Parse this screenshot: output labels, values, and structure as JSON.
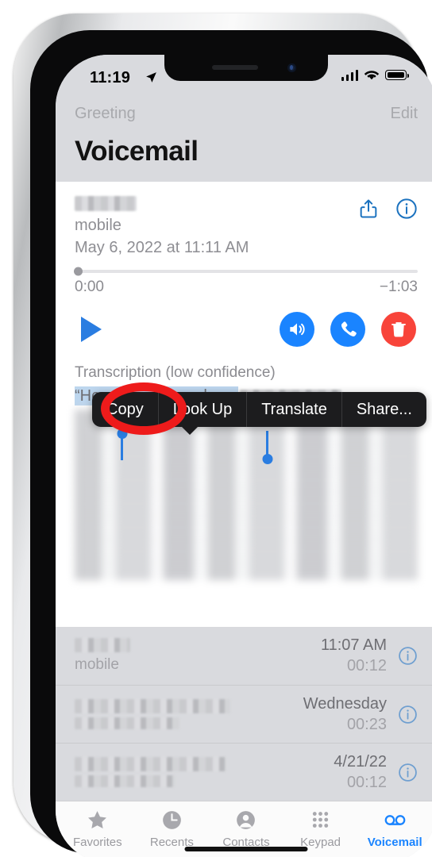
{
  "statusbar": {
    "time": "11:19",
    "location_icon": "location-arrow-icon",
    "signal_icon": "cellular-signal-icon",
    "wifi_icon": "wifi-icon",
    "battery_icon": "battery-icon"
  },
  "navbar": {
    "left_label": "Greeting",
    "right_label": "Edit",
    "title": "Voicemail"
  },
  "detail": {
    "contact_name_redacted": "",
    "phone_label": "mobile",
    "datetime": "May 6, 2022 at 11:11 AM",
    "share_icon": "share-icon",
    "info_icon": "info-circle-icon",
    "elapsed_time": "0:00",
    "remaining_time": "−1:03",
    "play_icon": "play-icon",
    "speaker_icon": "speaker-icon",
    "call_icon": "phone-icon",
    "delete_icon": "trash-icon"
  },
  "transcript": {
    "label": "Transcription (low confidence)",
    "selected_text": "“Hey John do you have",
    "accent_selection": "#bdd6ee",
    "handle_color": "#2a7de1"
  },
  "context_menu": {
    "items": [
      {
        "label": "Copy"
      },
      {
        "label": "Look Up"
      },
      {
        "label": "Translate"
      },
      {
        "label": "Share..."
      }
    ]
  },
  "annotation": {
    "shape": "ellipse-highlight",
    "color": "#ee1b1b",
    "targets": "Copy"
  },
  "list": {
    "rows": [
      {
        "name_redacted": "",
        "subtitle": "mobile",
        "time": "11:07 AM",
        "duration": "00:12",
        "info_icon": "info-circle-icon"
      },
      {
        "name_redacted": "",
        "subtitle": "",
        "time": "Wednesday",
        "duration": "00:23",
        "info_icon": "info-circle-icon"
      },
      {
        "name_redacted": "",
        "subtitle": "",
        "time": "4/21/22",
        "duration": "00:12",
        "info_icon": "info-circle-icon"
      }
    ]
  },
  "tabbar": {
    "tabs": [
      {
        "label": "Favorites",
        "icon": "star-icon",
        "active": false
      },
      {
        "label": "Recents",
        "icon": "clock-icon",
        "active": false
      },
      {
        "label": "Contacts",
        "icon": "person-icon",
        "active": false
      },
      {
        "label": "Keypad",
        "icon": "keypad-icon",
        "active": false
      },
      {
        "label": "Voicemail",
        "icon": "voicemail-icon",
        "active": true
      }
    ]
  },
  "colors": {
    "accent_blue": "#1a84ff",
    "delete_red": "#f8443a",
    "annotation_red": "#ee1b1b",
    "chrome_grey": "#d9dade"
  }
}
